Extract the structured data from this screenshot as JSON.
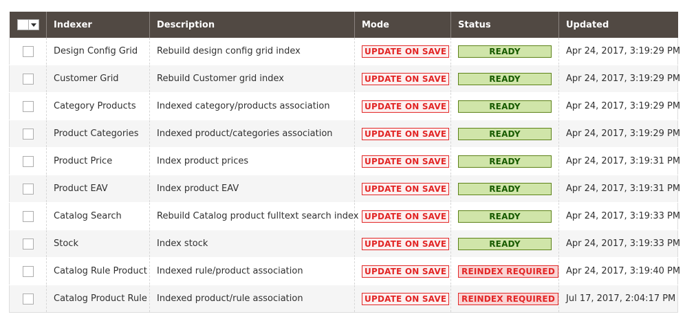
{
  "columns": {
    "indexer": "Indexer",
    "description": "Description",
    "mode": "Mode",
    "status": "Status",
    "updated": "Updated"
  },
  "colors": {
    "header_bg": "#514943",
    "mode_red": "#e22626",
    "ready_green_bg": "#d0e5a9",
    "ready_green_text": "#185b00",
    "reindex_bg": "#f9d4d4"
  },
  "rows": [
    {
      "indexer": "Design Config Grid",
      "description": "Rebuild design config grid index",
      "mode": "UPDATE ON SAVE",
      "status": "READY",
      "status_type": "ready",
      "updated": "Apr 24, 2017, 3:19:29 PM"
    },
    {
      "indexer": "Customer Grid",
      "description": "Rebuild Customer grid index",
      "mode": "UPDATE ON SAVE",
      "status": "READY",
      "status_type": "ready",
      "updated": "Apr 24, 2017, 3:19:29 PM"
    },
    {
      "indexer": "Category Products",
      "description": "Indexed category/products association",
      "mode": "UPDATE ON SAVE",
      "status": "READY",
      "status_type": "ready",
      "updated": "Apr 24, 2017, 3:19:29 PM"
    },
    {
      "indexer": "Product Categories",
      "description": "Indexed product/categories association",
      "mode": "UPDATE ON SAVE",
      "status": "READY",
      "status_type": "ready",
      "updated": "Apr 24, 2017, 3:19:29 PM"
    },
    {
      "indexer": "Product Price",
      "description": "Index product prices",
      "mode": "UPDATE ON SAVE",
      "status": "READY",
      "status_type": "ready",
      "updated": "Apr 24, 2017, 3:19:31 PM"
    },
    {
      "indexer": "Product EAV",
      "description": "Index product EAV",
      "mode": "UPDATE ON SAVE",
      "status": "READY",
      "status_type": "ready",
      "updated": "Apr 24, 2017, 3:19:31 PM"
    },
    {
      "indexer": "Catalog Search",
      "description": "Rebuild Catalog product fulltext search index",
      "mode": "UPDATE ON SAVE",
      "status": "READY",
      "status_type": "ready",
      "updated": "Apr 24, 2017, 3:19:33 PM"
    },
    {
      "indexer": "Stock",
      "description": "Index stock",
      "mode": "UPDATE ON SAVE",
      "status": "READY",
      "status_type": "ready",
      "updated": "Apr 24, 2017, 3:19:33 PM"
    },
    {
      "indexer": "Catalog Rule Product",
      "description": "Indexed rule/product association",
      "mode": "UPDATE ON SAVE",
      "status": "REINDEX REQUIRED",
      "status_type": "reindex",
      "updated": "Apr 24, 2017, 3:19:40 PM"
    },
    {
      "indexer": "Catalog Product Rule",
      "description": "Indexed product/rule association",
      "mode": "UPDATE ON SAVE",
      "status": "REINDEX REQUIRED",
      "status_type": "reindex",
      "updated": "Jul 17, 2017, 2:04:17 PM"
    }
  ]
}
